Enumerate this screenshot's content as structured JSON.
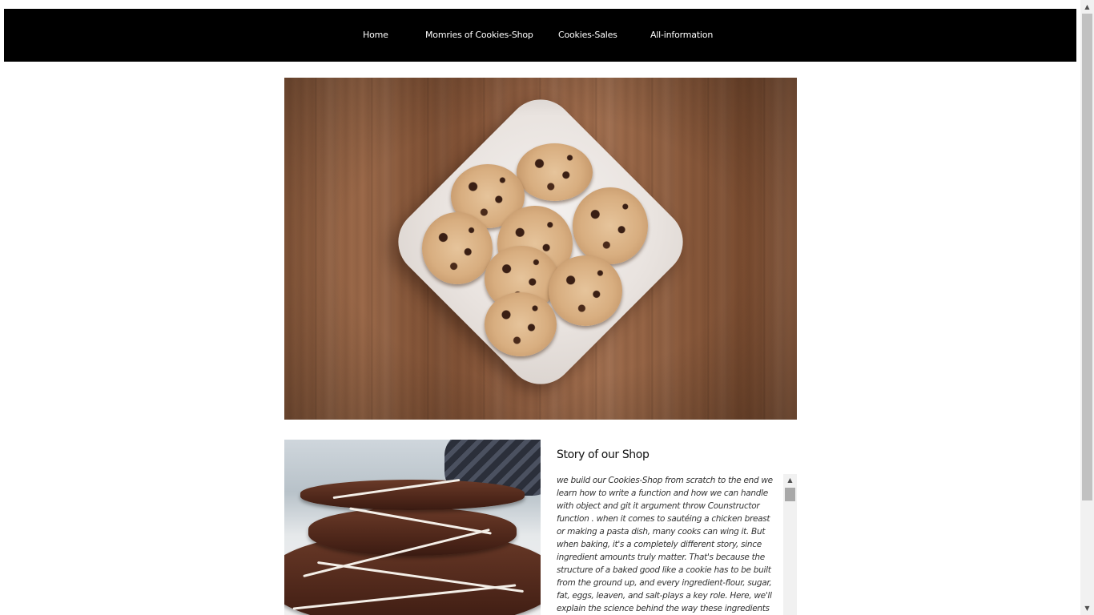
{
  "nav": {
    "home": "Home",
    "memories": "Momries of Cookies-Shop",
    "sales": "Cookies-Sales",
    "info": "All-information"
  },
  "hero": {
    "icon": "cookies-plate-photo"
  },
  "story": {
    "title": "Story of our Shop",
    "text": "we build our Cookies-Shop from scratch to the end we learn how to write a function and how we can handle with object and git it argument throw Counstructor function . when it comes to sautéing a chicken breast or making a pasta dish, many cooks can wing it. But when baking, it's a completely different story, since ingredient amounts truly matter. That's because the structure of a baked good like a cookie has to be built from the ground up, and every ingredient-flour, sugar, fat, eggs, leaven, and salt-plays a key role. Here, we'll explain the science behind the way these ingredients"
  },
  "colors": {
    "nav_bg": "#000000",
    "nav_text": "#ffffff",
    "page_bg": "#ffffff"
  }
}
